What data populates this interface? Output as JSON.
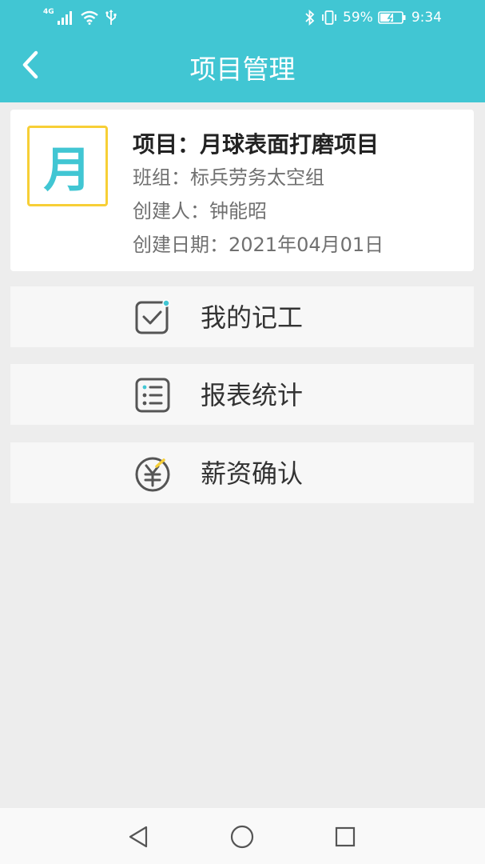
{
  "status_bar": {
    "network": "4G",
    "battery": "59%",
    "time": "9:34"
  },
  "header": {
    "title": "项目管理"
  },
  "project": {
    "avatar_char": "月",
    "name": "项目：月球表面打磨项目",
    "team": "班组：标兵劳务太空组",
    "creator": "创建人：钟能昭",
    "created_date": "创建日期：2021年04月01日"
  },
  "menu": {
    "items": [
      {
        "label": "我的记工",
        "icon": "checkbox-icon"
      },
      {
        "label": "报表统计",
        "icon": "list-icon"
      },
      {
        "label": "薪资确认",
        "icon": "yuan-icon"
      }
    ]
  },
  "colors": {
    "accent": "#41c6d3",
    "avatar_border": "#f7cf36",
    "icon_gray": "#555555"
  }
}
